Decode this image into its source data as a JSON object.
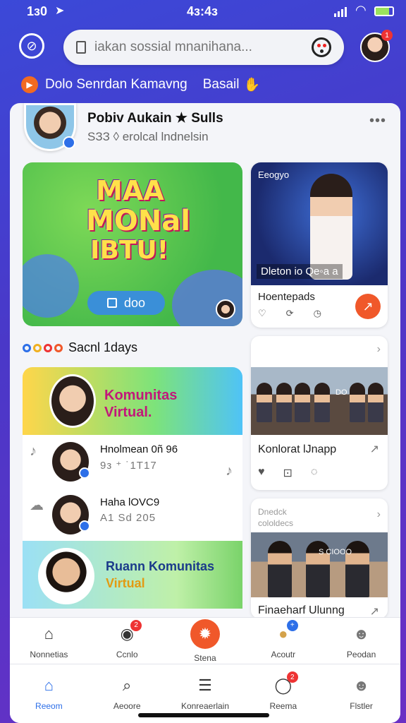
{
  "status_bar": {
    "time": "1з0",
    "center_time": "4з:4з"
  },
  "search": {
    "placeholder": "iakan sossial mnanihana..."
  },
  "banner": {
    "text": "Dolo Senrdan Kamavng",
    "text2": "Basail"
  },
  "profile": {
    "name": "Pobiv Aukain ★ Sulls",
    "subtitle": "SЗЗ ◊ erolcal lndnelsin"
  },
  "featured_card": {
    "line1": "MAA",
    "line2": "MONal",
    "line3": "IBTU!",
    "pill_label": "doo"
  },
  "stage_card": {
    "tag": "Eeogyo",
    "caption": "Dleton io Qe◦a a",
    "title": "Hoentepads"
  },
  "section": {
    "title": "Sacnl 1days"
  },
  "komunitas_card": {
    "line1": "Komunitas",
    "line2": "Virtual."
  },
  "list": [
    {
      "name": "Hnolmean 0ñ 96",
      "sub": "9з ⁺ ˙1Т17"
    },
    {
      "name": "Haha lOVC9",
      "sub": "A1 Sd 205"
    }
  ],
  "ruang_card": {
    "line1": "Ruann Komunitas",
    "line2": "Virtual"
  },
  "meeting_card": {
    "caption": "DO",
    "title": "Konlorat lJnapp"
  },
  "team_card": {
    "heading1": "Dnedck",
    "heading2": "cololdecs",
    "caption": "S CIOOO",
    "title": "Finaeharf Ulunng"
  },
  "nav_top": [
    {
      "label": "Nonnetias",
      "icon": "home-icon"
    },
    {
      "label": "Ccnlo",
      "icon": "gamepad-icon",
      "badge": "2"
    },
    {
      "label": "Stena",
      "icon": "settings-gear-icon"
    },
    {
      "label": "Acoutr",
      "icon": "chat-bubble-icon"
    },
    {
      "label": "Peodan",
      "icon": "person-icon"
    }
  ],
  "nav_bottom": [
    {
      "label": "Reeom",
      "icon": "home-icon"
    },
    {
      "label": "Aeoore",
      "icon": "search-icon"
    },
    {
      "label": "Konreaerlain",
      "icon": "list-icon"
    },
    {
      "label": "Reema",
      "icon": "chat-icon",
      "badge": "2"
    },
    {
      "label": "Flstler",
      "icon": "profile-icon"
    }
  ],
  "colors": {
    "accent": "#2d6fe8",
    "orange": "#f0582a",
    "background": "#3b49d8"
  }
}
